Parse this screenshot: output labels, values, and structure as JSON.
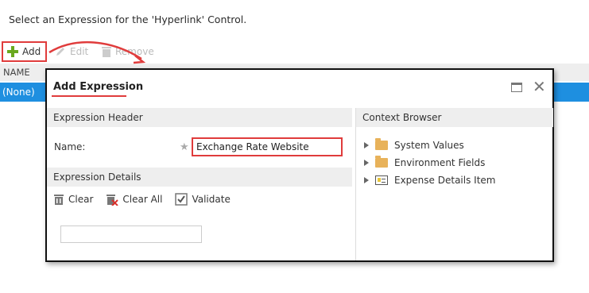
{
  "instruction": "Select an Expression for the 'Hyperlink' Control.",
  "toolbar": {
    "add_label": "Add",
    "edit_label": "Edit",
    "remove_label": "Remove"
  },
  "grid": {
    "column_header": "NAME",
    "rows": [
      {
        "name": "(None)",
        "selected": true
      }
    ]
  },
  "dialog": {
    "title": "Add Expression",
    "header_section": "Expression Header",
    "name_label": "Name:",
    "name_value": "Exchange Rate Website",
    "details_section": "Expression Details",
    "tools": {
      "clear": "Clear",
      "clear_all": "Clear All",
      "validate": "Validate"
    },
    "context_browser": {
      "title": "Context Browser",
      "items": [
        {
          "label": "System Values",
          "icon": "folder-icon"
        },
        {
          "label": "Environment Fields",
          "icon": "folder-icon"
        },
        {
          "label": "Expense Details Item",
          "icon": "form-item-icon"
        }
      ]
    }
  },
  "colors": {
    "highlight": "#e03c3c",
    "selection": "#1e8fe0",
    "add_icon": "#6aa81f",
    "folder": "#e8b25a"
  }
}
